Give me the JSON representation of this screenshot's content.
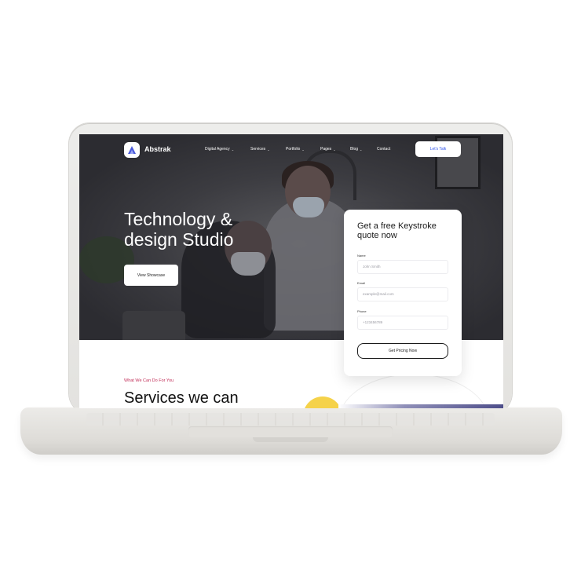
{
  "brand": {
    "name": "Abstrak"
  },
  "nav": {
    "items": [
      {
        "label": "Digital Agency",
        "has_dropdown": true
      },
      {
        "label": "Services",
        "has_dropdown": true
      },
      {
        "label": "Portfolio",
        "has_dropdown": true
      },
      {
        "label": "Pages",
        "has_dropdown": true
      },
      {
        "label": "Blog",
        "has_dropdown": true
      },
      {
        "label": "Contact",
        "has_dropdown": false
      }
    ],
    "cta_label": "Let's Talk"
  },
  "hero": {
    "title": "Technology & design Studio",
    "button_label": "View Showcase"
  },
  "quote_form": {
    "title": "Get a free Keystroke quote now",
    "fields": [
      {
        "label": "Name",
        "placeholder": "John Smith"
      },
      {
        "label": "Email",
        "placeholder": "example@mail.com"
      },
      {
        "label": "Phone",
        "placeholder": "+123456789"
      }
    ],
    "submit_label": "Get Pricing Now"
  },
  "services": {
    "eyebrow": "What We Can Do For You",
    "title": "Services we can"
  },
  "icons": {
    "logo": "abstrak-logo-icon",
    "dropdown": "chevron-down-icon"
  },
  "colors": {
    "accent": "#2f54eb",
    "eyebrow": "#c2305a",
    "hero_overlay": "#2f2f34",
    "highlight": "#f5d24a"
  }
}
